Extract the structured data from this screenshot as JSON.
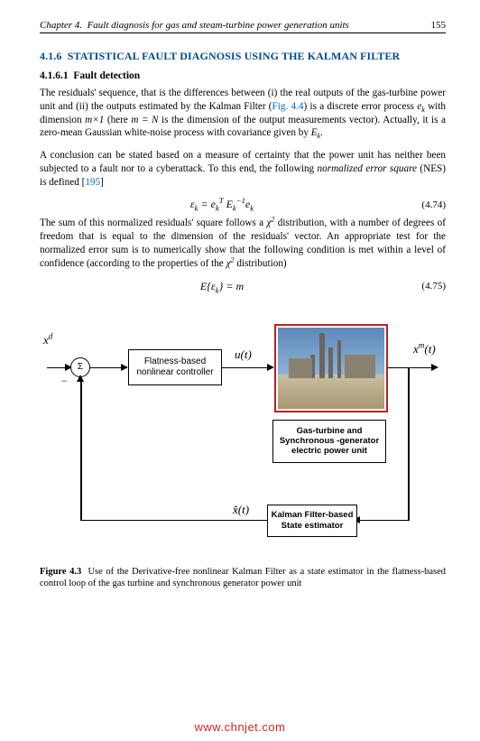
{
  "header": {
    "chapter_label": "Chapter 4.",
    "chapter_title": "Fault diagnosis for gas and steam-turbine power generation units",
    "page_number": "155"
  },
  "section": {
    "number": "4.1.6",
    "title": "STATISTICAL FAULT DIAGNOSIS USING THE KALMAN FILTER"
  },
  "subsection": {
    "number": "4.1.6.1",
    "title": "Fault detection"
  },
  "paragraphs": {
    "p1a": "The residuals' sequence, that is the differences between (i) the real outputs of the gas-turbine power unit and (ii) the outputs estimated by the Kalman Filter (",
    "p1_figref": "Fig. 4.4",
    "p1b": ") is a discrete error process ",
    "p1_ek": "e",
    "p1_ek_sub": "k",
    "p1c": " with dimension ",
    "p1_mxN": "m×1",
    "p1d": " (here ",
    "p1_mN": "m = N",
    "p1e": " is the dimension of the output measurements vector). Actually, it is a zero-mean Gaussian white-noise process with covariance given by ",
    "p1_Ek": "E",
    "p1_Ek_sub": "k",
    "p1f": ".",
    "p2a": "A conclusion can be stated based on a measure of certainty that the power unit has neither been subjected to a fault nor to a cyberattack. To this end, the following ",
    "p2_nes_ital": "normalized error square",
    "p2b": " (NES) is defined [",
    "p2_cite": "195",
    "p2c": "]",
    "p3a": "The sum of this normalized residuals' square follows a ",
    "p3_chi": "χ",
    "p3_chi_sup": "2",
    "p3b": " distribution, with a number of degrees of freedom that is equal to the dimension of the residuals' vector. An appropriate test for the normalized error sum is to numerically show that the following condition is met within a level of confidence (according to the properties of the ",
    "p3_chi2": "χ",
    "p3_chi2_sup": "2",
    "p3c": " distribution)"
  },
  "equations": {
    "eq1_text": "εk = ekT Ek−1 ek",
    "eq1_num": "(4.74)",
    "eq2_text": "E{εk} = m",
    "eq2_num": "(4.75)"
  },
  "figure": {
    "vars": {
      "xd": "x d",
      "u": "u(t)",
      "xm": "x m(t)",
      "xhat": "x̂(t)"
    },
    "nodes": {
      "sum": "Σ",
      "controller_l1": "Flatness-based",
      "controller_l2": "nonlinear controller",
      "plant_l1": "Gas-turbine and",
      "plant_l2": "Synchronous -generator",
      "plant_l3": "electric power unit",
      "estimator_l1": "Kalman Filter-based",
      "estimator_l2": "State estimator"
    },
    "caption_bold": "Figure 4.3",
    "caption_text": "Use of the Derivative-free nonlinear Kalman Filter as a state estimator in the flatness-based control loop of the gas turbine and synchronous generator power unit"
  },
  "watermark": "www.chnjet.com"
}
